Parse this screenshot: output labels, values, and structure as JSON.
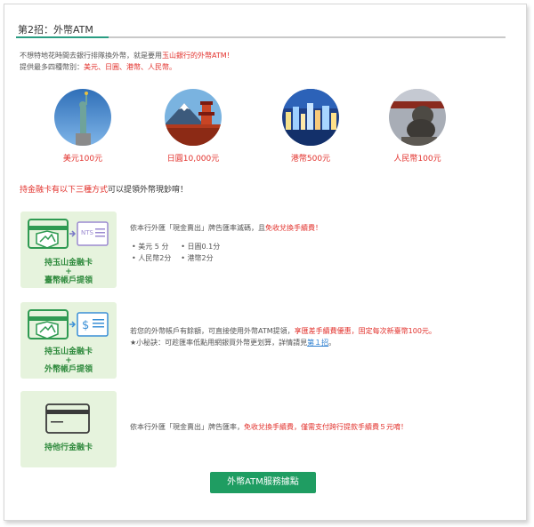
{
  "heading": "第2招：外幣ATM",
  "intro": {
    "line1_prefix": "不想特地花時間去銀行排隊換外幣，就是要用",
    "line1_highlight": "玉山銀行的外幣ATM！",
    "line2_prefix": "提供最多四種幣別：",
    "line2_highlight": "美元、日圓、港幣、人民幣。"
  },
  "currencies": [
    {
      "label": "美元100元",
      "icon": "statue-of-liberty-photo"
    },
    {
      "label": "日圓10,000元",
      "icon": "mount-fuji-pagoda-photo"
    },
    {
      "label": "港幣500元",
      "icon": "hong-kong-night-skyline-photo"
    },
    {
      "label": "人民幣100元",
      "icon": "chinese-stone-lion-photo"
    }
  ],
  "methods_intro": {
    "highlight": "持金融卡有以下三種方式",
    "suffix": "可以提領外幣現鈔唷！"
  },
  "methods": [
    {
      "card_line1": "持玉山金融卡",
      "card_plus": "+",
      "card_line2": "臺幣帳戶提領",
      "icon": "card-to-ntd-icon",
      "desc_prefix": "依本行外匯「現金賣出」牌告匯率滅碼，且",
      "desc_highlight": "免收兌換手續費！",
      "rates": [
        "美元 5 分",
        "日圓0.1分",
        "人民幣2分",
        "港幣2分"
      ]
    },
    {
      "card_line1": "持玉山金融卡",
      "card_plus": "+",
      "card_line2": "外幣帳戶提領",
      "icon": "card-to-dollar-icon",
      "desc_prefix": "若您的外幣帳戶有餘額，可直接使用外幣ATM提領，",
      "desc_highlight": "享匯差手續費優惠，固定每次新臺幣100元。",
      "tip_prefix": "★小秘訣：可趁匯率低點用網銀買外幣更划算，詳情請見",
      "tip_link": "第１招",
      "tip_suffix": "。"
    },
    {
      "card_line1": "持他行金融卡",
      "icon": "plain-card-icon",
      "desc_prefix": "依本行外匯「現金賣出」牌告匯率，",
      "desc_highlight": "免收兌換手續費，僅需支付跨行提款手續費５元唷！"
    }
  ],
  "cta_label": "外幣ATM服務據點",
  "colors": {
    "accent_green": "#1f9d62",
    "highlight_red": "#e2302b",
    "card_bg": "#e6f3dd"
  }
}
